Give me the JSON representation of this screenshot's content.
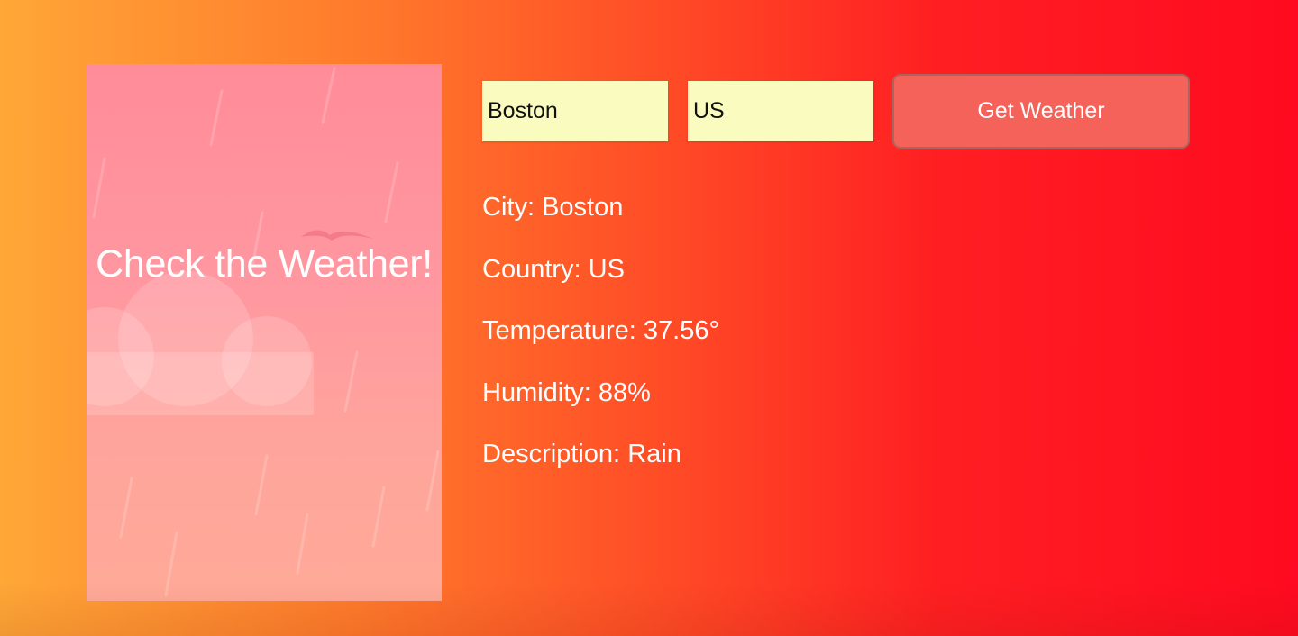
{
  "hero": {
    "title": "Check the Weather!"
  },
  "form": {
    "city_value": "Boston",
    "country_value": "US",
    "submit_label": "Get Weather"
  },
  "results": {
    "city_label": "City:",
    "city": "Boston",
    "country_label": "Country:",
    "country": "US",
    "temperature_label": "Temperature:",
    "temperature": "37.56°",
    "humidity_label": "Humidity:",
    "humidity": "88%",
    "description_label": "Description:",
    "description": "Rain"
  },
  "colors": {
    "background_start": "#ffa737",
    "background_end": "#ff0a20",
    "panel": "#ff8c99",
    "input_background": "#fafcbf",
    "button": "#f56259",
    "text": "#ffffff"
  },
  "icons": [
    "rain-illustration",
    "cloud-icon",
    "bird-icon"
  ]
}
